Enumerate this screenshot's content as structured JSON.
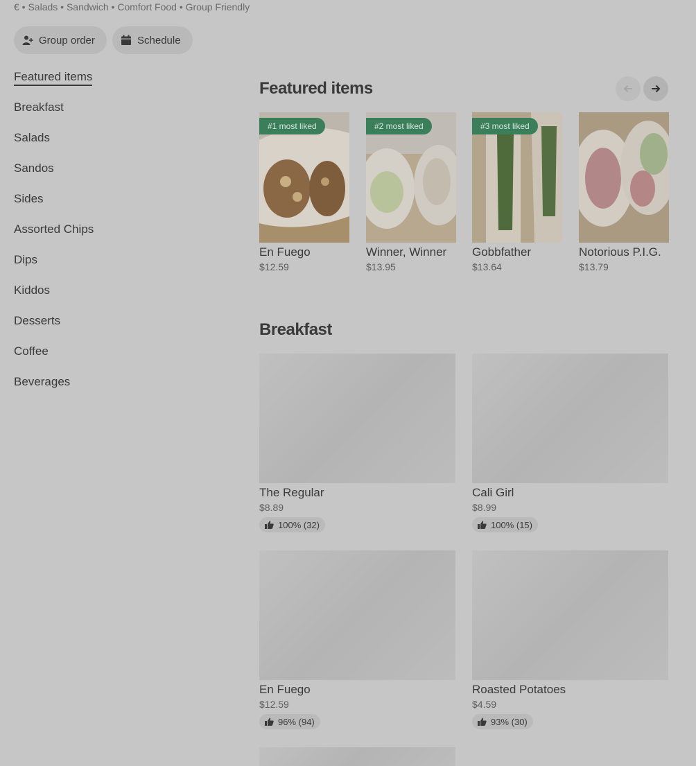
{
  "store": {
    "tagline": "€ • Salads • Sandwich • Comfort Food • Group Friendly"
  },
  "actions": {
    "group_order": "Group order",
    "schedule": "Schedule"
  },
  "nav": {
    "items": [
      {
        "label": "Featured items",
        "active": true
      },
      {
        "label": "Breakfast"
      },
      {
        "label": "Salads"
      },
      {
        "label": "Sandos"
      },
      {
        "label": "Sides"
      },
      {
        "label": "Assorted Chips"
      },
      {
        "label": "Dips"
      },
      {
        "label": "Kiddos"
      },
      {
        "label": "Desserts"
      },
      {
        "label": "Coffee"
      },
      {
        "label": "Beverages"
      }
    ]
  },
  "featured": {
    "title": "Featured items",
    "items": [
      {
        "name": "En Fuego",
        "price": "$12.59",
        "badge": "#1 most liked"
      },
      {
        "name": "Winner, Winner",
        "price": "$13.95",
        "badge": "#2 most liked"
      },
      {
        "name": "Gobbfather",
        "price": "$13.64",
        "badge": "#3 most liked"
      },
      {
        "name": "Notorious P.I.G.",
        "price": "$13.79",
        "badge": ""
      }
    ]
  },
  "breakfast": {
    "title": "Breakfast",
    "items": [
      {
        "name": "The Regular",
        "price": "$8.89",
        "rating": "100% (32)"
      },
      {
        "name": "Cali Girl",
        "price": "$8.99",
        "rating": "100% (15)"
      },
      {
        "name": "En Fuego",
        "price": "$12.59",
        "rating": "96% (94)"
      },
      {
        "name": "Roasted Potatoes",
        "price": "$4.59",
        "rating": "93% (30)"
      }
    ]
  },
  "colors": {
    "badge_green": "#3b7f5a",
    "overlay_gray": "#c6c6c6"
  }
}
